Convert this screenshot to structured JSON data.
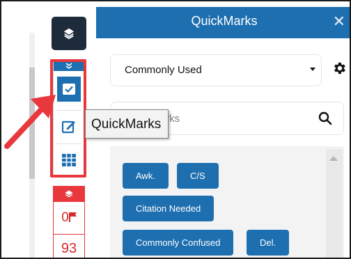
{
  "panel": {
    "title": "QuickMarks",
    "close_glyph": "✕",
    "set_select": {
      "value": "Commonly Used"
    },
    "search": {
      "placeholder": "QuickMarks"
    },
    "quickmarks": [
      "Awk.",
      "C/S",
      "Citation Needed",
      "Commonly Confused",
      "Del."
    ]
  },
  "toolbar": {
    "icons": [
      "layers-icon",
      "checkbox-icon",
      "edit-icon",
      "grid-icon"
    ],
    "flag_count": "0",
    "score": "93"
  },
  "tooltip": {
    "text": "QuickMarks"
  },
  "colors": {
    "accent": "#1e6fb0",
    "dark": "#1e2b3a",
    "highlight": "#e8383d"
  }
}
